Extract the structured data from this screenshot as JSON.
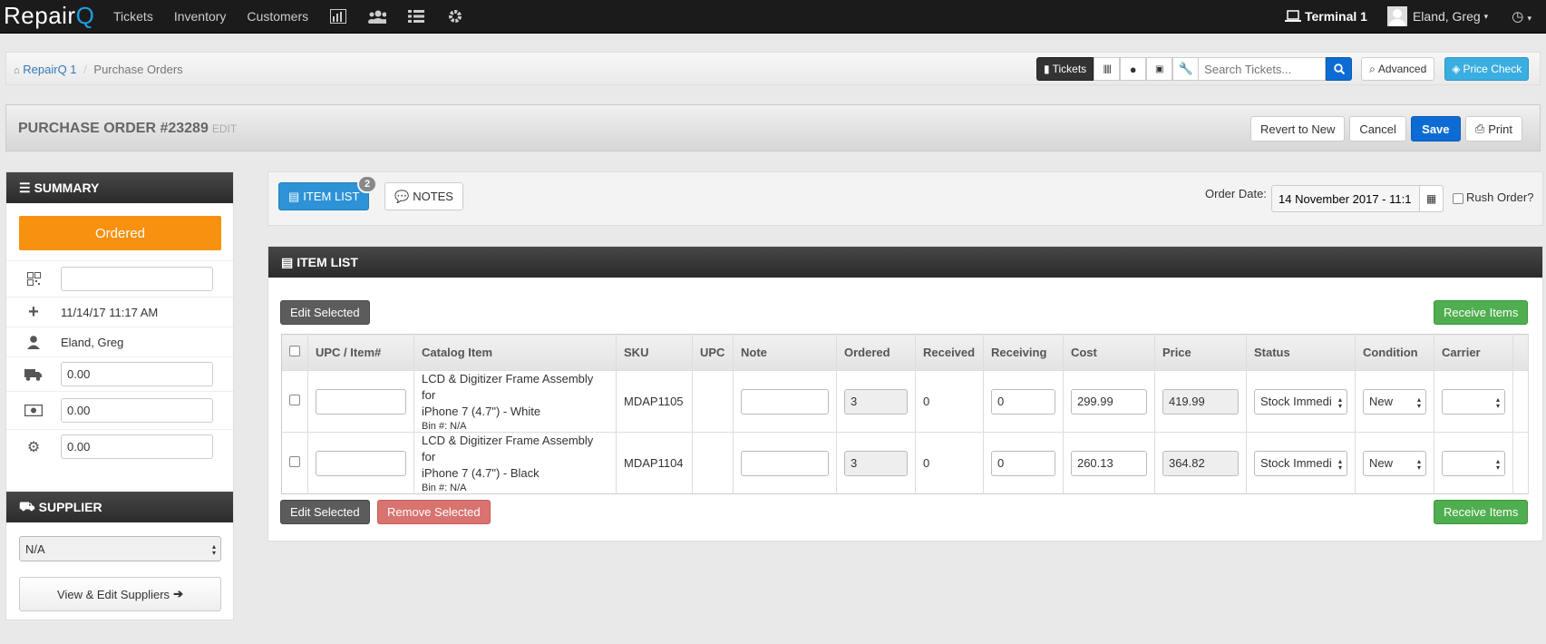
{
  "app": {
    "logo_main": "Repair",
    "logo_q": "Q"
  },
  "topnav": {
    "tickets": "Tickets",
    "inventory": "Inventory",
    "customers": "Customers"
  },
  "topright": {
    "terminal": "Terminal 1",
    "user": "Eland, Greg"
  },
  "breadcrumb": {
    "home": "RepairQ 1",
    "sep": "/",
    "current": "Purchase Orders"
  },
  "toolbar": {
    "tickets": "Tickets",
    "search_placeholder": "Search Tickets...",
    "advanced": "Advanced",
    "price_check": "Price Check"
  },
  "page": {
    "title": "PURCHASE ORDER #23289",
    "title_suffix": "EDIT",
    "revert": "Revert to New",
    "cancel": "Cancel",
    "save": "Save",
    "print": "Print"
  },
  "summary": {
    "heading": "SUMMARY",
    "status": "Ordered",
    "code": "",
    "date": "11/14/17 11:17 AM",
    "user": "Eland, Greg",
    "shipping": "0.00",
    "tax": "0.00",
    "other": "0.00"
  },
  "supplier": {
    "heading": "SUPPLIER",
    "selected": "N/A",
    "view_edit": "View & Edit Suppliers"
  },
  "tabs": {
    "item_list": "ITEM LIST",
    "item_count": "2",
    "notes": "NOTES",
    "order_date_label": "Order Date:",
    "order_date": "14 November 2017 - 11:1",
    "rush": "Rush Order?"
  },
  "item_list": {
    "heading": "ITEM LIST",
    "edit_selected": "Edit Selected",
    "remove_selected": "Remove Selected",
    "receive_items": "Receive Items",
    "columns": [
      "UPC / Item#",
      "Catalog Item",
      "SKU",
      "UPC",
      "Note",
      "Ordered",
      "Received",
      "Receiving",
      "Cost",
      "Price",
      "Status",
      "Condition",
      "Carrier"
    ],
    "rows": [
      {
        "upc_item": "",
        "catalog_line1": "LCD & Digitizer Frame Assembly for",
        "catalog_line2": "iPhone 7 (4.7\") - White",
        "bin": "Bin #: N/A",
        "sku": "MDAP1105",
        "upc": "",
        "note": "",
        "ordered": "3",
        "received": "0",
        "receiving": "0",
        "cost": "299.99",
        "price": "419.99",
        "status": "Stock Immedi",
        "condition": "New",
        "carrier": ""
      },
      {
        "upc_item": "",
        "catalog_line1": "LCD & Digitizer Frame Assembly for",
        "catalog_line2": "iPhone 7 (4.7\") - Black",
        "bin": "Bin #: N/A",
        "sku": "MDAP1104",
        "upc": "",
        "note": "",
        "ordered": "3",
        "received": "0",
        "receiving": "0",
        "cost": "260.13",
        "price": "364.82",
        "status": "Stock Immedi",
        "condition": "New",
        "carrier": ""
      }
    ]
  }
}
